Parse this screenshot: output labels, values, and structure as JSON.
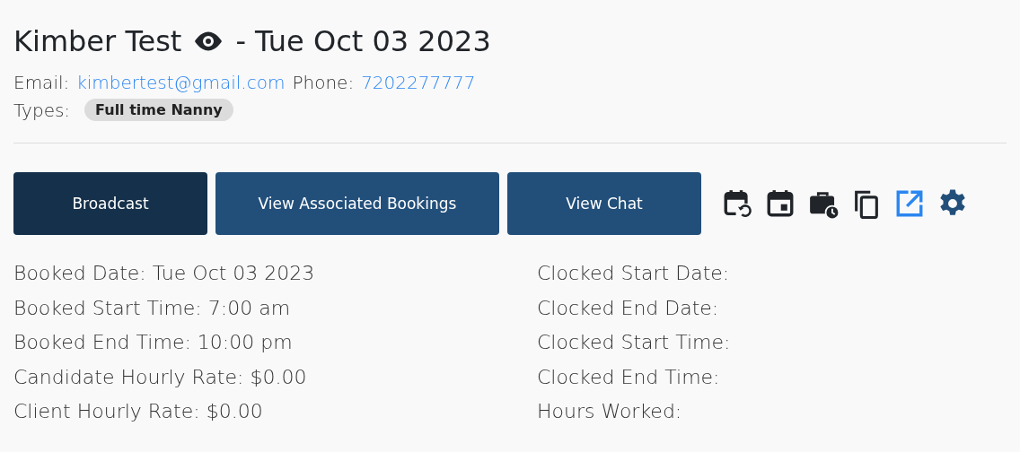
{
  "header": {
    "name": "Kimber Test",
    "date_suffix": "- Tue Oct 03 2023"
  },
  "contact": {
    "email_label": "Email:",
    "email": "kimbertest@gmail.com",
    "phone_label": "Phone:",
    "phone": "7202277777"
  },
  "types": {
    "label": "Types:",
    "tags": [
      "Full time Nanny"
    ]
  },
  "buttons": [
    {
      "label": "Broadcast",
      "kind": "dark"
    },
    {
      "label": "View Associated Bookings",
      "kind": "normal"
    },
    {
      "label": "View Chat",
      "kind": "normal"
    }
  ],
  "icons": [
    {
      "kind": "calendar-history"
    },
    {
      "kind": "calendar-day"
    },
    {
      "kind": "briefcase-clock"
    },
    {
      "kind": "copy"
    },
    {
      "kind": "open-external"
    },
    {
      "kind": "settings"
    }
  ],
  "booked_details": [
    "Booked Date: Tue Oct 03 2023",
    "Booked Start Time: 7:00 am",
    "Booked End Time: 10:00 pm",
    "Candidate Hourly Rate: $0.00",
    "Client Hourly Rate: $0.00"
  ],
  "clocked_details": [
    "Clocked Start Date:",
    "Clocked End Date:",
    "Clocked Start Time:",
    "Clocked End Time:",
    "Hours Worked:"
  ]
}
